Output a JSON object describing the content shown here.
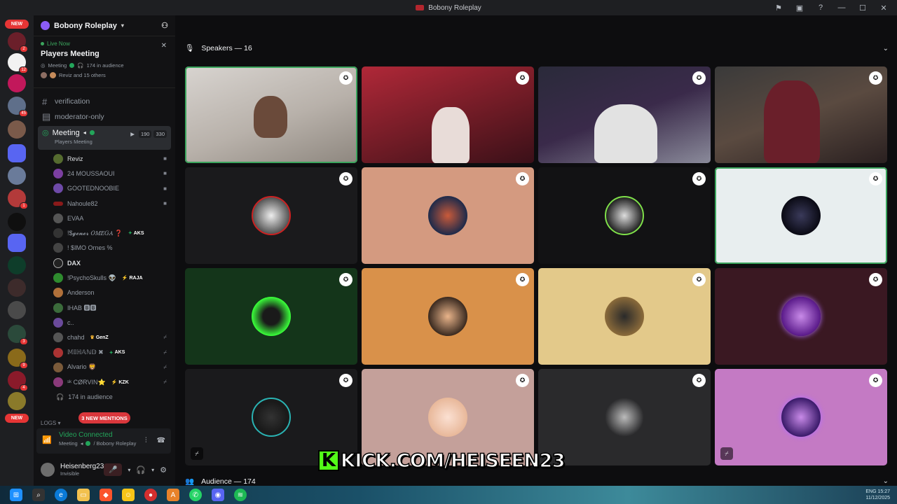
{
  "window": {
    "title": "Bobony Roleplay"
  },
  "rail": {
    "new_top": "NEW",
    "new_bottom": "NEW",
    "badges": [
      "2",
      "12",
      "45",
      "1",
      "3",
      "9",
      "4"
    ]
  },
  "server": {
    "name": "Bobony Roleplay"
  },
  "event": {
    "status": "Live Now",
    "name": "Players Meeting",
    "channel": "Meeting",
    "audience": "174 in audience",
    "others": "Reviz and 15 others"
  },
  "channels": [
    {
      "name": "verification"
    },
    {
      "name": "moderator-only"
    }
  ],
  "meeting": {
    "name": "Meeting",
    "sub": "Players Meeting",
    "count_a": "190",
    "count_b": "330"
  },
  "users": [
    {
      "name": "Reviz",
      "tag": "",
      "icon": "video-icon"
    },
    {
      "name": "24 MOUSSAOUI",
      "tag": "",
      "icon": "video-icon"
    },
    {
      "name": "GOOTEDNOOBIE",
      "tag": "",
      "icon": "video-icon"
    },
    {
      "name": "Nahoule82",
      "tag": "",
      "icon": "video-icon"
    },
    {
      "name": "EVAA",
      "tag": "",
      "icon": ""
    },
    {
      "name": "!$𝓰𝓮𝓷𝓮𝓻 𝑂𝑀𝐸𝐺𝐴 ❓",
      "tag": "AKS",
      "icon": ""
    },
    {
      "name": "! $IMO Ornes %",
      "tag": "",
      "icon": ""
    },
    {
      "name": "DAX",
      "tag": "",
      "icon": ""
    },
    {
      "name": "!PsychoSkulls 👽",
      "tag": "RAJA",
      "icon": ""
    },
    {
      "name": "Anderson",
      "tag": "",
      "icon": ""
    },
    {
      "name": "IHAB 🅱🅱",
      "tag": "",
      "icon": ""
    },
    {
      "name": "c..",
      "tag": "",
      "icon": ""
    },
    {
      "name": "chahd",
      "tag": "GenZ",
      "icon": "mute-icon"
    },
    {
      "name": "𝕄𝕀ℍ𝔸ℕ𝔻 ✖",
      "tag": "AKS",
      "icon": "mute-icon"
    },
    {
      "name": "Alvario 🦁",
      "tag": "",
      "icon": "mute-icon"
    },
    {
      "name": "ˢᵏ CØRVIN⭐",
      "tag": "KZK",
      "icon": "mute-icon"
    }
  ],
  "audience_line": "174 in audience",
  "logs": "LOGS",
  "mentions": "3 NEW MENTIONS",
  "voice": {
    "status": "Video Connected",
    "channel": "Meeting",
    "server": "/ Bobony Roleplay"
  },
  "me": {
    "name": "Heisenberg23",
    "status": "Invisible"
  },
  "stage": {
    "speakers": "Speakers — 16",
    "audience": "Audience — 174"
  },
  "overlay": {
    "kick_logo": "K",
    "kick_text": "KICK.COM/HEISEEN23"
  },
  "tray": {
    "lang": "ENG",
    "time": "15:27",
    "date": "11/12/2025"
  },
  "colors": {
    "accent_green": "#23a55a",
    "mention_red": "#da373c",
    "kick_green": "#53fc18"
  }
}
